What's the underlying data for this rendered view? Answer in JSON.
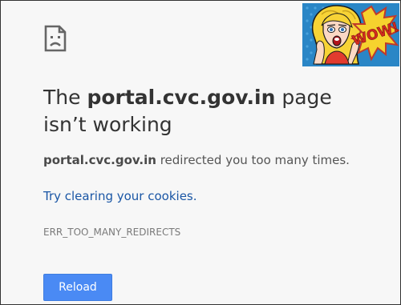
{
  "error_page": {
    "title_prefix": "The ",
    "title_host": "portal.cvc.gov.in",
    "title_suffix": " page isn’t working",
    "subtitle_host": "portal.cvc.gov.in",
    "subtitle_rest": " redirected you too many times.",
    "suggestion_link": "Try clearing your cookies.",
    "error_code": "ERR_TOO_MANY_REDIRECTS",
    "reload_label": "Reload",
    "icon": "sad-page-icon"
  },
  "meme": {
    "text": "WOW!"
  },
  "colors": {
    "link": "#1a56a5",
    "button": "#4a8af4",
    "text": "#333333"
  }
}
